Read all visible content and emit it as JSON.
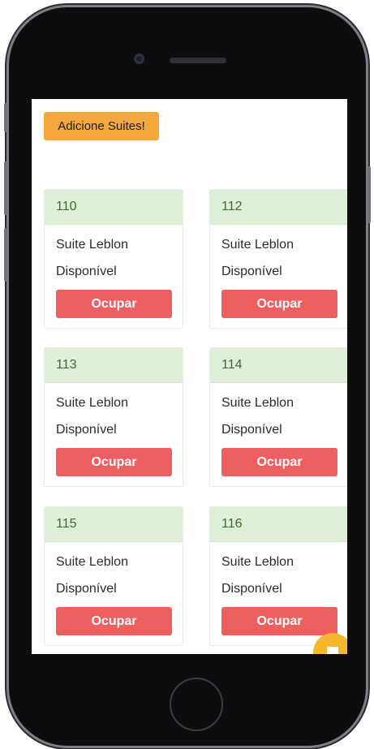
{
  "header": {
    "add_button_label": "Adicione Suites!"
  },
  "suites": [
    {
      "number": "110",
      "name": "Suite Leblon",
      "status": "Disponível",
      "action": "Ocupar"
    },
    {
      "number": "112",
      "name": "Suite Leblon",
      "status": "Disponível",
      "action": "Ocupar"
    },
    {
      "number": "113",
      "name": "Suite Leblon",
      "status": "Disponível",
      "action": "Ocupar"
    },
    {
      "number": "114",
      "name": "Suite Leblon",
      "status": "Disponível",
      "action": "Ocupar"
    },
    {
      "number": "115",
      "name": "Suite Leblon",
      "status": "Disponível",
      "action": "Ocupar"
    },
    {
      "number": "116",
      "name": "Suite Leblon",
      "status": "Disponível",
      "action": "Ocupar"
    }
  ],
  "icons": {
    "chat": "chat-icon"
  },
  "colors": {
    "accent": "#f4a73a",
    "danger": "#ee5f5f",
    "card_header": "#dff0d8",
    "card_header_text": "#3b6b2f"
  }
}
